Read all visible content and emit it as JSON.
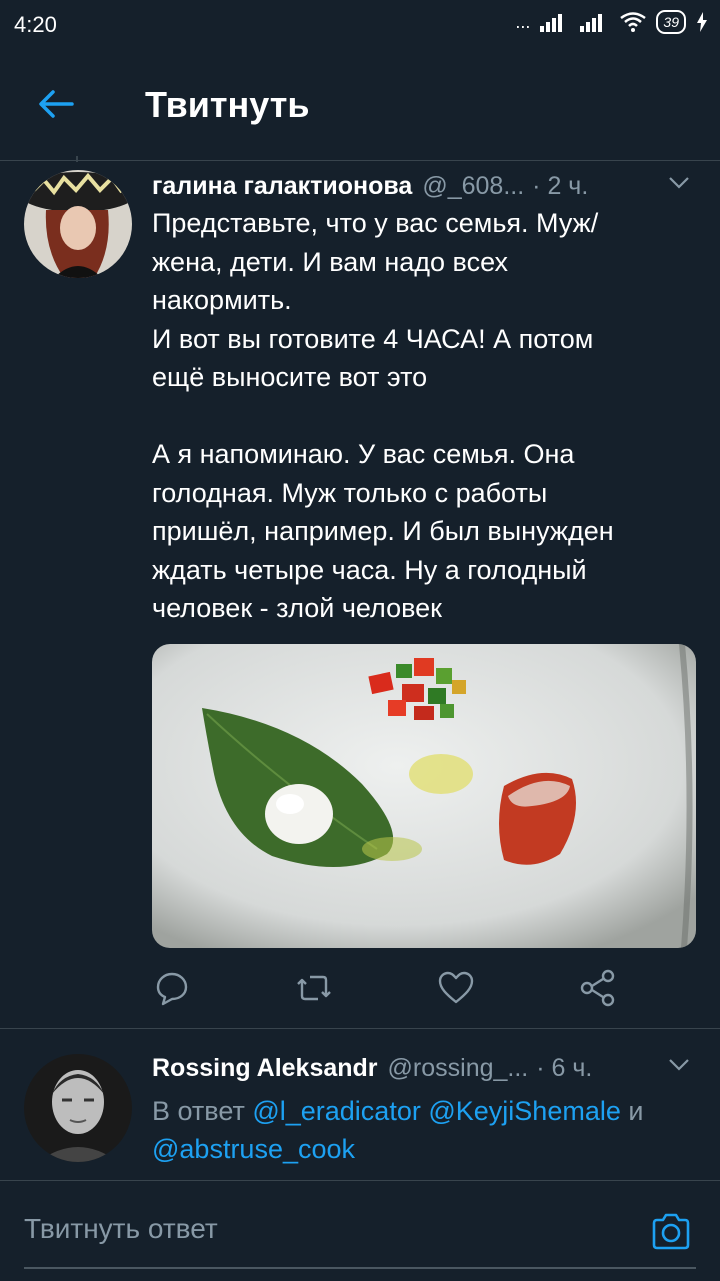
{
  "status_bar": {
    "time": "4:20",
    "signal": "...",
    "battery": "39"
  },
  "header": {
    "title": "Твитнуть",
    "back_icon": "arrow-left-icon"
  },
  "tweet": {
    "name": "галина галактионова",
    "handle": "@_608...",
    "time": "· 2 ч.",
    "text": "Представьте, что у вас семья. Муж/\nжена, дети. И вам надо всех\nнакормить.\nИ вот вы готовите 4 ЧАСА! А потом\nещё выносите вот это\n\nА я напоминаю. У вас семья. Она\nголодная. Муж только с работы\nпришёл, например. И был вынужден\nждать четыре часа. Ну а голодный\nчеловек - злой человек"
  },
  "reply": {
    "name": "Rossing Aleksandr",
    "handle": "@rossing_...",
    "time": "· 6 ч.",
    "prefix": "В ответ",
    "mention1": "@l_eradicator",
    "mention2": "@KeyjiShemale",
    "conj": "и",
    "mention3": "@abstruse_cook"
  },
  "compose": {
    "placeholder": "Твитнуть ответ"
  },
  "colors": {
    "background": "#15202b",
    "accent": "#1da1f2",
    "secondary_text": "#8899a6",
    "divider": "#38444d"
  }
}
